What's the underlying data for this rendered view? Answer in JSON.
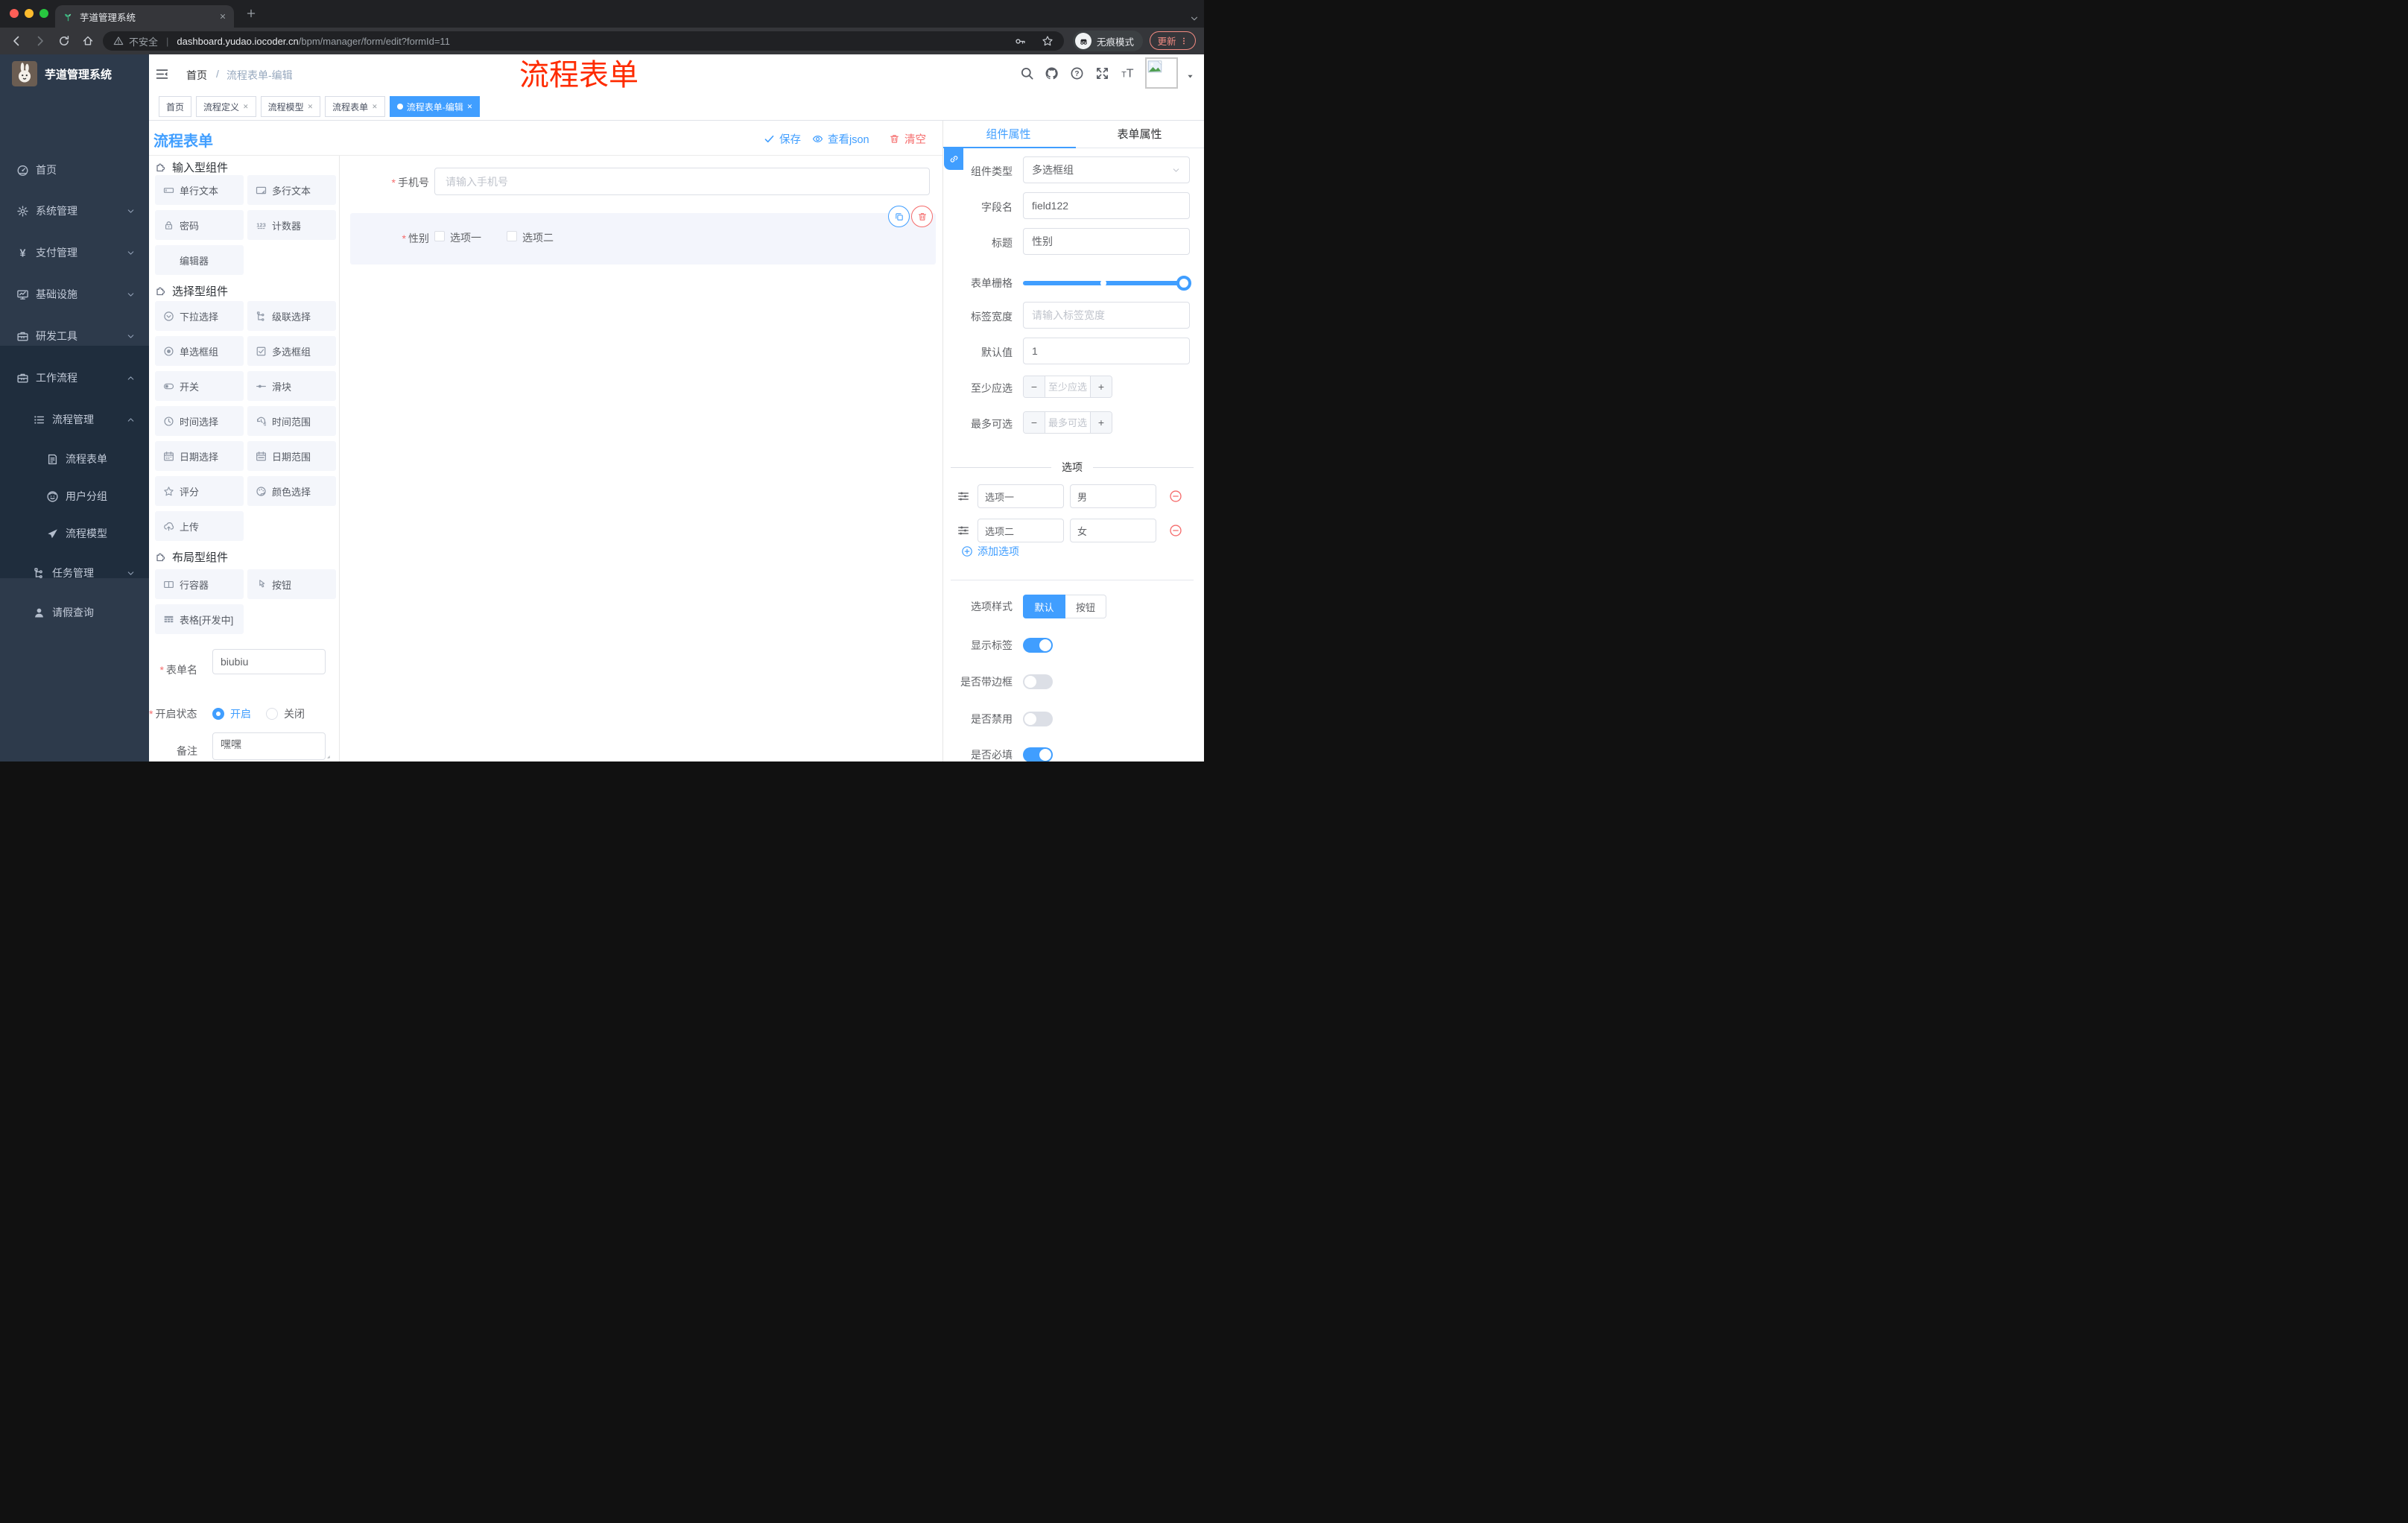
{
  "colors": {
    "primary": "#409eff",
    "danger": "#f56c6c",
    "annotation_red": "#fe2b00",
    "sidebar_bg": "#2d3a4b",
    "submenu_bg": "#1f2d3d",
    "chrome_bg": "#202124",
    "toolbar_bg": "#35363a"
  },
  "browser": {
    "tab_title": "芋道管理系统",
    "security_label": "不安全",
    "url_host": "dashboard.yudao.iocoder.cn",
    "url_path": "/bpm/manager/form/edit?formId=11",
    "incognito_label": "无痕模式",
    "update_label": "更新",
    "nav_icons": [
      "back-arrow",
      "forward-arrow",
      "reload",
      "home"
    ],
    "omnibox_icons": [
      "alert-triangle",
      "key",
      "star"
    ]
  },
  "annotation": {
    "text": "流程表单"
  },
  "sidebar": {
    "logo_title": "芋道管理系统",
    "items": [
      {
        "label": "首页",
        "icon": "dashboard",
        "chevron": null
      },
      {
        "label": "系统管理",
        "icon": "gear",
        "chevron": "down"
      },
      {
        "label": "支付管理",
        "icon": "yen",
        "chevron": "down"
      },
      {
        "label": "基础设施",
        "icon": "monitor",
        "chevron": "down"
      },
      {
        "label": "研发工具",
        "icon": "toolbox",
        "chevron": "down"
      },
      {
        "label": "工作流程",
        "icon": "toolbox",
        "chevron": "up"
      }
    ],
    "submenu": [
      {
        "label": "流程管理",
        "icon": "list-tree",
        "chevron": "up",
        "level": 1
      },
      {
        "label": "流程表单",
        "icon": "doc-edit",
        "chevron": null,
        "level": 2
      },
      {
        "label": "用户分组",
        "icon": "user-circle",
        "chevron": null,
        "level": 2
      },
      {
        "label": "流程模型",
        "icon": "paper-plane",
        "chevron": null,
        "level": 2
      },
      {
        "label": "任务管理",
        "icon": "flow-tree",
        "chevron": "down",
        "level": 1
      },
      {
        "label": "请假查询",
        "icon": "person",
        "chevron": null,
        "level": 1
      }
    ]
  },
  "header": {
    "breadcrumb_home": "首页",
    "breadcrumb_sep": "/",
    "breadcrumb_current": "流程表单-编辑",
    "action_icons": [
      "search",
      "github",
      "help",
      "fullscreen",
      "font-size"
    ]
  },
  "tags": [
    {
      "label": "首页",
      "closable": false,
      "active": false
    },
    {
      "label": "流程定义",
      "closable": true,
      "active": false
    },
    {
      "label": "流程模型",
      "closable": true,
      "active": false
    },
    {
      "label": "流程表单",
      "closable": true,
      "active": false
    },
    {
      "label": "流程表单-编辑",
      "closable": true,
      "active": true
    }
  ],
  "designer": {
    "title": "流程表单",
    "actions": {
      "save": "保存",
      "view_json": "查看json",
      "clear": "清空"
    },
    "components": {
      "sections": [
        {
          "title": "输入型组件",
          "items": [
            {
              "label": "单行文本",
              "icon": "text-field"
            },
            {
              "label": "多行文本",
              "icon": "textarea"
            },
            {
              "label": "密码",
              "icon": "lock"
            },
            {
              "label": "计数器",
              "icon": "counter"
            },
            {
              "label": "编辑器",
              "icon": null
            }
          ]
        },
        {
          "title": "选择型组件",
          "items": [
            {
              "label": "下拉选择",
              "icon": "dropdown"
            },
            {
              "label": "级联选择",
              "icon": "cascade"
            },
            {
              "label": "单选框组",
              "icon": "radio"
            },
            {
              "label": "多选框组",
              "icon": "checkbox"
            },
            {
              "label": "开关",
              "icon": "switch"
            },
            {
              "label": "滑块",
              "icon": "slider"
            },
            {
              "label": "时间选择",
              "icon": "clock"
            },
            {
              "label": "时间范围",
              "icon": "time-range"
            },
            {
              "label": "日期选择",
              "icon": "calendar"
            },
            {
              "label": "日期范围",
              "icon": "calendar-range"
            },
            {
              "label": "评分",
              "icon": "star"
            },
            {
              "label": "颜色选择",
              "icon": "palette"
            },
            {
              "label": "上传",
              "icon": "upload-cloud"
            }
          ]
        },
        {
          "title": "布局型组件",
          "items": [
            {
              "label": "行容器",
              "icon": "row-container"
            },
            {
              "label": "按钮",
              "icon": "pointer"
            },
            {
              "label": "表格[开发中]",
              "icon": "table-grid"
            }
          ]
        }
      ]
    },
    "form_meta": {
      "name_label": "表单名",
      "name_value": "biubiu",
      "status_label": "开启状态",
      "status_options": [
        "开启",
        "关闭"
      ],
      "status_selected": "开启",
      "remark_label": "备注",
      "remark_value": "嘿嘿"
    },
    "canvas": {
      "phone_field": {
        "required": "*",
        "label": "手机号",
        "placeholder": "请输入手机号"
      },
      "gender_field": {
        "required": "*",
        "label": "性别",
        "options": [
          "选项一",
          "选项二"
        ]
      }
    },
    "properties": {
      "tab_component": "组件属性",
      "tab_form": "表单属性",
      "component_type_label": "组件类型",
      "component_type_value": "多选框组",
      "field_name_label": "字段名",
      "field_name_value": "field122",
      "title_label": "标题",
      "title_value": "性别",
      "grid_label": "表单栅格",
      "label_width_label": "标签宽度",
      "label_width_placeholder": "请输入标签宽度",
      "default_label": "默认值",
      "default_value": "1",
      "min_label": "至少应选",
      "min_placeholder": "至少应选",
      "max_label": "最多可选",
      "max_placeholder": "最多可选",
      "options_divider": "选项",
      "options": [
        {
          "label": "选项一",
          "value": "男"
        },
        {
          "label": "选项二",
          "value": "女"
        }
      ],
      "add_option": "添加选项",
      "style_label": "选项样式",
      "style_default": "默认",
      "style_button": "按钮",
      "toggles": [
        {
          "label": "显示标签",
          "on": true
        },
        {
          "label": "是否带边框",
          "on": false
        },
        {
          "label": "是否禁用",
          "on": false
        },
        {
          "label": "是否必填",
          "on": true
        }
      ]
    }
  }
}
